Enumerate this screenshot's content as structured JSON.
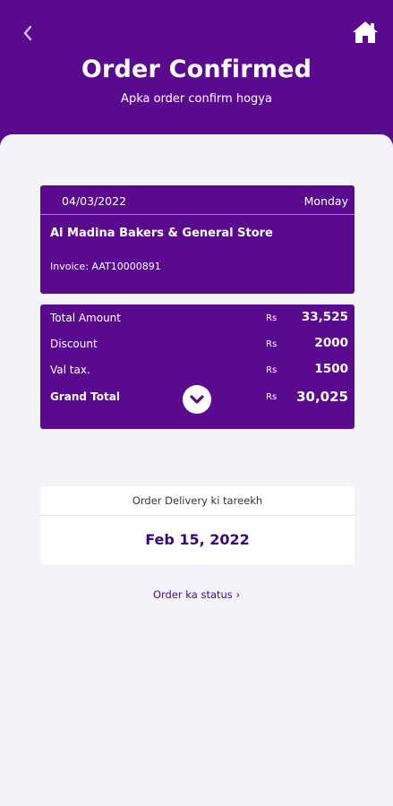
{
  "header": {
    "title": "Order Confirmed",
    "subtitle": "Apka order confirm hogya",
    "back_icon": "chevron-left-icon",
    "home_icon": "home-icon"
  },
  "order": {
    "date": "04/03/2022",
    "day": "Monday",
    "store": "Al Madina Bakers & General Store",
    "invoice": "Invoice: AAT10000891"
  },
  "summary": {
    "rows": [
      {
        "label": "Total Amount",
        "currency": "Rs",
        "amount": "33,525"
      },
      {
        "label": "Discount",
        "currency": "Rs",
        "amount": "2000"
      },
      {
        "label": "Val tax.",
        "currency": "Rs",
        "amount": "1500"
      },
      {
        "label": "Grand Total",
        "currency": "Rs",
        "amount": "30,025"
      }
    ],
    "expand_icon": "chevron-down-circle-icon"
  },
  "delivery": {
    "label": "Order Delivery ki tareekh",
    "date": "Feb 15, 2022"
  },
  "status_link": "Order ka status  ›",
  "colors": {
    "primary": "#5a0a8e",
    "background": "#f4f3fa",
    "accent_text": "#3d0872"
  }
}
